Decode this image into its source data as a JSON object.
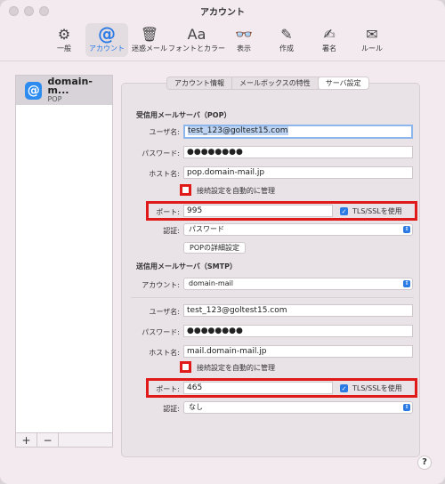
{
  "window": {
    "title": "アカウント"
  },
  "toolbar": {
    "items": [
      {
        "icon": "gear-icon",
        "glyph": "⚙",
        "label": "一般"
      },
      {
        "icon": "at-sign-icon",
        "glyph": "@",
        "label": "アカウント"
      },
      {
        "icon": "junk-mail-icon",
        "glyph": "🗑",
        "label": "迷惑メール"
      },
      {
        "icon": "fonts-icon",
        "glyph": "Aa",
        "label": "フォントとカラー"
      },
      {
        "icon": "glasses-icon",
        "glyph": "👓",
        "label": "表示"
      },
      {
        "icon": "compose-icon",
        "glyph": "✎",
        "label": "作成"
      },
      {
        "icon": "signature-icon",
        "glyph": "✍",
        "label": "署名"
      },
      {
        "icon": "rules-icon",
        "glyph": "✉",
        "label": "ルール"
      }
    ]
  },
  "accounts": {
    "items": [
      {
        "name": "domain-m...",
        "type": "POP",
        "icon_glyph": "@"
      }
    ],
    "add_label": "+",
    "remove_label": "−"
  },
  "tabs": [
    {
      "label": "アカウント情報"
    },
    {
      "label": "メールボックスの特性"
    },
    {
      "label": "サーバ設定"
    }
  ],
  "incoming": {
    "heading": "受信用メールサーバ（POP）",
    "username_label": "ユーザ名:",
    "username": "test_123@goltest15.com",
    "password_label": "パスワード:",
    "password": "●●●●●●●●",
    "host_label": "ホスト名:",
    "host": "pop.domain-mail.jp",
    "auto_manage_label": "接続設定を自動的に管理",
    "port_label": "ポート:",
    "port": "995",
    "tls_label": "TLS/SSLを使用",
    "auth_label": "認証:",
    "auth": "パスワード",
    "advanced_button": "POPの詳細設定"
  },
  "outgoing": {
    "heading": "送信用メールサーバ（SMTP）",
    "account_label": "アカウント:",
    "account": "domain-mail",
    "username_label": "ユーザ名:",
    "username": "test_123@goltest15.com",
    "password_label": "パスワード:",
    "password": "●●●●●●●●",
    "host_label": "ホスト名:",
    "host": "mail.domain-mail.jp",
    "auto_manage_label": "接続設定を自動的に管理",
    "port_label": "ポート:",
    "port": "465",
    "tls_label": "TLS/SSLを使用",
    "auth_label": "認証:",
    "auth": "なし"
  },
  "help_label": "?",
  "colors": {
    "accent": "#2c7be5",
    "highlight_red": "#e01919"
  }
}
